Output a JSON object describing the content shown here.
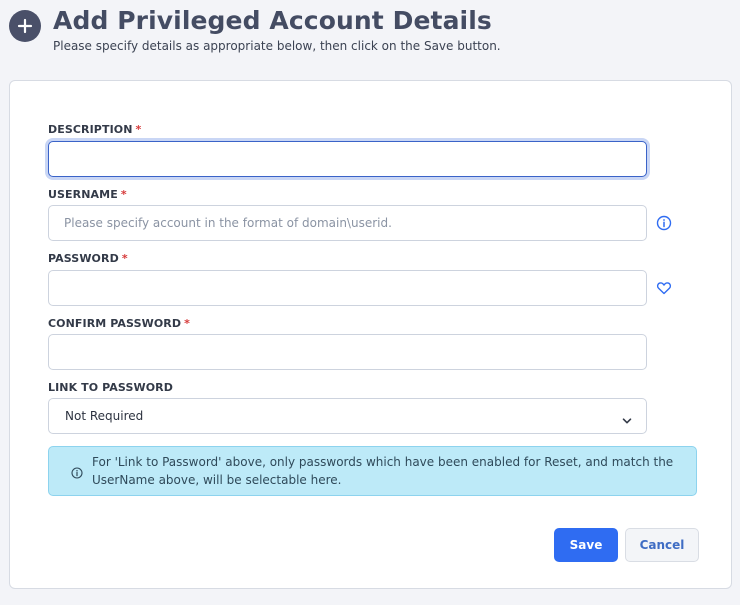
{
  "header": {
    "title": "Add Privileged Account Details",
    "subtitle": "Please specify details as appropriate below, then click on the Save button.",
    "icon": "plus-icon"
  },
  "form": {
    "description": {
      "label": "DESCRIPTION",
      "required_marker": "*",
      "value": "",
      "placeholder": ""
    },
    "username": {
      "label": "USERNAME",
      "required_marker": "*",
      "value": "",
      "placeholder": "Please specify account in the format of domain\\userid.",
      "side_icon": "info-icon"
    },
    "password": {
      "label": "PASSWORD",
      "required_marker": "*",
      "value": "",
      "placeholder": "",
      "side_icon": "heart-icon"
    },
    "confirm_password": {
      "label": "CONFIRM PASSWORD",
      "required_marker": "*",
      "value": "",
      "placeholder": ""
    },
    "link_to_password": {
      "label": "LINK TO PASSWORD",
      "selected": "Not Required",
      "icon": "chevron-down-icon"
    }
  },
  "info_box": {
    "text": "For 'Link to Password' above, only passwords which have been enabled for Reset, and match the UserName above, will be selectable here.",
    "icon": "info-icon"
  },
  "actions": {
    "save_label": "Save",
    "cancel_label": "Cancel"
  },
  "colors": {
    "primary": "#2f6cf2",
    "header_icon_bg": "#4a5069",
    "required": "#d63a3a",
    "info_bg": "#bdeaf8",
    "link_icon": "#2f6cf2"
  }
}
